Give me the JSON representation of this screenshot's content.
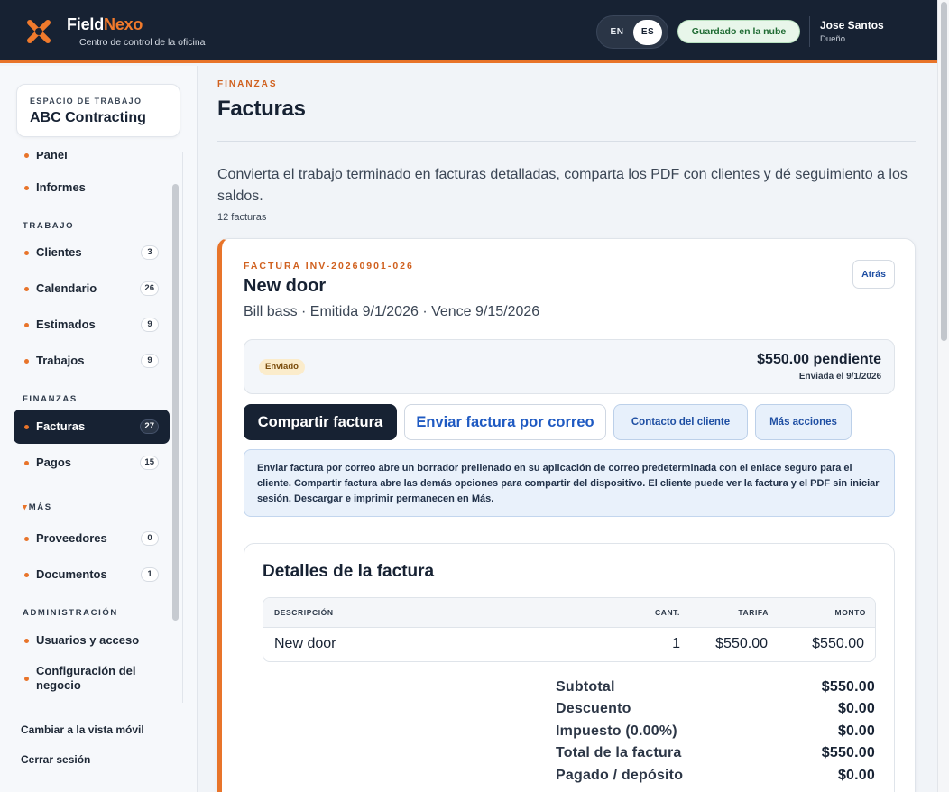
{
  "header": {
    "brand_part1": "Field",
    "brand_part2": "Nexo",
    "subtitle": "Centro de control de la oficina",
    "lang_en": "EN",
    "lang_es": "ES",
    "cloud_status": "Guardado en la nube",
    "user_name": "Jose Santos",
    "user_role": "Dueño",
    "accent_color": "#e8742a"
  },
  "sidebar": {
    "workspace_label": "ESPACIO DE TRABAJO",
    "workspace_name": "ABC Contracting",
    "partial_item": "Panel",
    "items": {
      "informes": "Informes",
      "clientes": "Clientes",
      "calendario": "Calendario",
      "estimados": "Estimados",
      "trabajos": "Trabajos",
      "facturas": "Facturas",
      "pagos": "Pagos",
      "proveedores": "Proveedores",
      "documentos": "Documentos",
      "usuarios": "Usuarios y acceso",
      "configuracion": "Configuración del negocio"
    },
    "counts": {
      "clientes": "3",
      "calendario": "26",
      "estimados": "9",
      "trabajos": "9",
      "facturas": "27",
      "pagos": "15",
      "proveedores": "0",
      "documentos": "1"
    },
    "sections": {
      "trabajo": "TRABAJO",
      "finanzas": "FINANZAS",
      "mas": "MÁS",
      "admin": "ADMINISTRACIÓN"
    },
    "mobile_link": "Cambiar a la vista móvil",
    "logout_link": "Cerrar sesión"
  },
  "main": {
    "eyebrow": "FINANZAS",
    "title": "Facturas",
    "intro": "Convierta el trabajo terminado en facturas detalladas, comparta los PDF con clientes y dé seguimiento a los saldos.",
    "count": "12 facturas"
  },
  "invoice": {
    "eyebrow": "FACTURA INV-20260901-026",
    "title": "New door",
    "meta": "Bill bass · Emitida 9/1/2026 · Vence 9/15/2026",
    "back": "Atrás",
    "status": "Enviado",
    "due": "$550.00 pendiente",
    "sent": "Enviada el 9/1/2026",
    "actions": {
      "share": "Compartir factura",
      "email": "Enviar factura por correo",
      "contact": "Contacto del cliente",
      "more": "Más acciones"
    },
    "help": "Enviar factura por correo abre un borrador prellenado en su aplicación de correo predeterminada con el enlace seguro para el cliente. Compartir factura abre las demás opciones para compartir del dispositivo. El cliente puede ver la factura y el PDF sin iniciar sesión. Descargar e imprimir permanecen en Más.",
    "details_title": "Detalles de la factura",
    "table": {
      "headers": {
        "description": "DESCRIPCIÓN",
        "qty": "CANT.",
        "rate": "TARIFA",
        "amount": "MONTO"
      },
      "rows": [
        {
          "description": "New door",
          "qty": "1",
          "rate": "$550.00",
          "amount": "$550.00"
        }
      ]
    },
    "totals": {
      "subtotal_label": "Subtotal",
      "subtotal": "$550.00",
      "discount_label": "Descuento",
      "discount": "$0.00",
      "tax_label": "Impuesto (0.00%)",
      "tax": "$0.00",
      "total_label": "Total de la factura",
      "total": "$550.00",
      "paid_label": "Pagado / depósito",
      "paid": "$0.00"
    }
  }
}
